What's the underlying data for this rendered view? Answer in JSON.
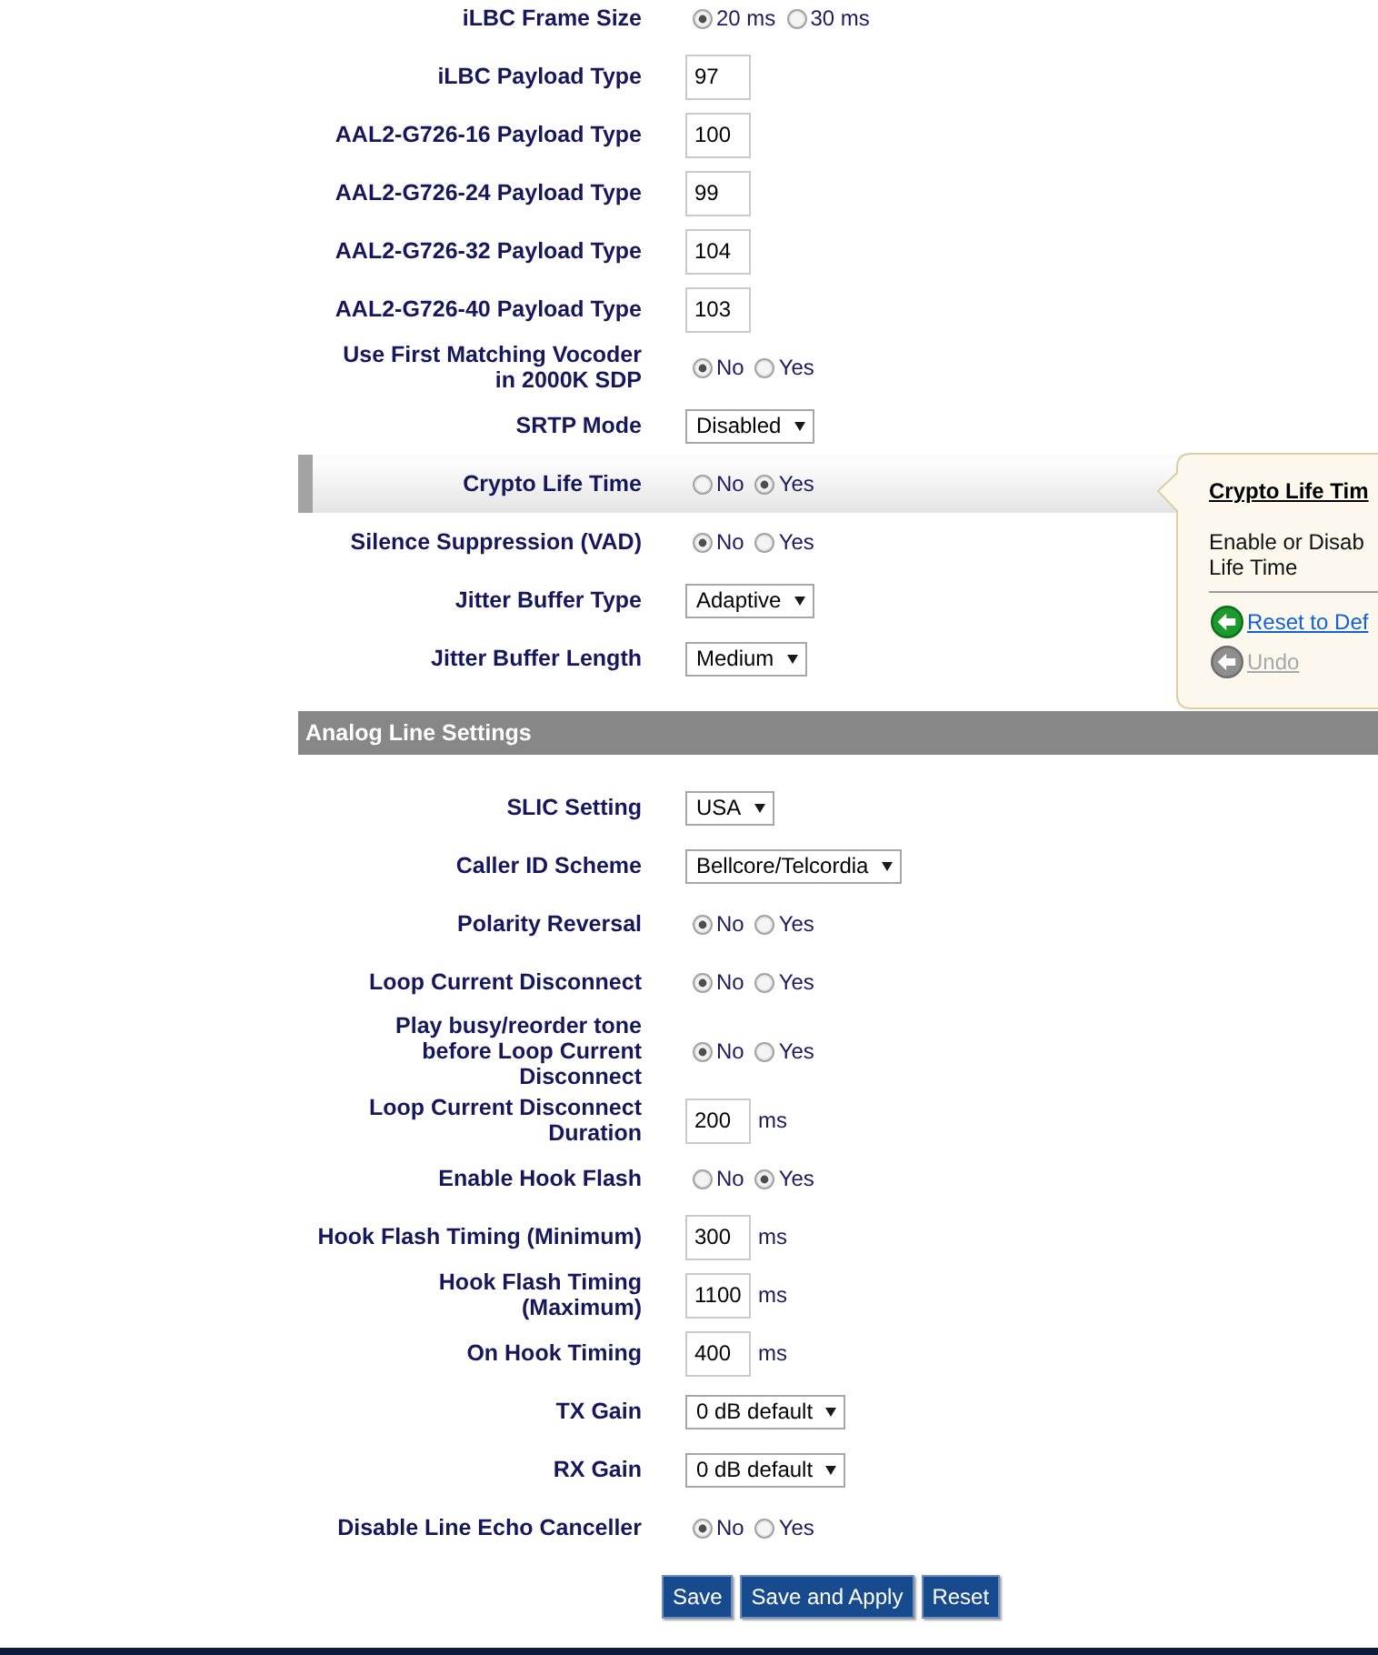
{
  "sections": [
    {
      "rows": [
        {
          "label": "iLBC Frame Size",
          "kind": "radio",
          "highlighted": false,
          "options": [
            {
              "label": "20 ms",
              "selected": true
            },
            {
              "label": "30 ms",
              "selected": false
            }
          ]
        },
        {
          "label": "iLBC Payload Type",
          "kind": "text",
          "highlighted": false,
          "value": "97"
        },
        {
          "label": "AAL2-G726-16 Payload Type",
          "kind": "text",
          "highlighted": false,
          "value": "100"
        },
        {
          "label": "AAL2-G726-24 Payload Type",
          "kind": "text",
          "highlighted": false,
          "value": "99"
        },
        {
          "label": "AAL2-G726-32 Payload Type",
          "kind": "text",
          "highlighted": false,
          "value": "104"
        },
        {
          "label": "AAL2-G726-40 Payload Type",
          "kind": "text",
          "highlighted": false,
          "value": "103"
        },
        {
          "label": "Use First Matching Vocoder\nin 2000K SDP",
          "kind": "radio",
          "highlighted": false,
          "options": [
            {
              "label": "No",
              "selected": true
            },
            {
              "label": "Yes",
              "selected": false
            }
          ]
        },
        {
          "label": "SRTP Mode",
          "kind": "select",
          "highlighted": false,
          "value": "Disabled"
        },
        {
          "label": "Crypto Life Time",
          "kind": "radio",
          "highlighted": true,
          "options": [
            {
              "label": "No",
              "selected": false
            },
            {
              "label": "Yes",
              "selected": true
            }
          ]
        },
        {
          "label": "Silence Suppression (VAD)",
          "kind": "radio",
          "highlighted": false,
          "options": [
            {
              "label": "No",
              "selected": true
            },
            {
              "label": "Yes",
              "selected": false
            }
          ]
        },
        {
          "label": "Jitter Buffer Type",
          "kind": "select",
          "highlighted": false,
          "value": "Adaptive"
        },
        {
          "label": "Jitter Buffer Length",
          "kind": "select",
          "highlighted": false,
          "value": "Medium"
        }
      ]
    },
    {
      "title": "Analog Line Settings",
      "rows": [
        {
          "label": "SLIC Setting",
          "kind": "select",
          "highlighted": false,
          "value": "USA"
        },
        {
          "label": "Caller ID Scheme",
          "kind": "select",
          "highlighted": false,
          "value": "Bellcore/Telcordia"
        },
        {
          "label": "Polarity Reversal",
          "kind": "radio",
          "highlighted": false,
          "options": [
            {
              "label": "No",
              "selected": true
            },
            {
              "label": "Yes",
              "selected": false
            }
          ]
        },
        {
          "label": "Loop Current Disconnect",
          "kind": "radio",
          "highlighted": false,
          "options": [
            {
              "label": "No",
              "selected": true
            },
            {
              "label": "Yes",
              "selected": false
            }
          ]
        },
        {
          "label": "Play busy/reorder tone\nbefore Loop Current\nDisconnect",
          "kind": "radio",
          "highlighted": false,
          "options": [
            {
              "label": "No",
              "selected": true
            },
            {
              "label": "Yes",
              "selected": false
            }
          ]
        },
        {
          "label": "Loop Current Disconnect\nDuration",
          "kind": "text",
          "highlighted": false,
          "value": "200",
          "unit": "ms"
        },
        {
          "label": "Enable Hook Flash",
          "kind": "radio",
          "highlighted": false,
          "options": [
            {
              "label": "No",
              "selected": false
            },
            {
              "label": "Yes",
              "selected": true
            }
          ]
        },
        {
          "label": "Hook Flash Timing (Minimum)",
          "kind": "text",
          "highlighted": false,
          "value": "300",
          "unit": "ms"
        },
        {
          "label": "Hook Flash Timing\n(Maximum)",
          "kind": "text",
          "highlighted": false,
          "value": "1100",
          "unit": "ms"
        },
        {
          "label": "On Hook Timing",
          "kind": "text",
          "highlighted": false,
          "value": "400",
          "unit": "ms"
        },
        {
          "label": "TX Gain",
          "kind": "select",
          "highlighted": false,
          "value": "0 dB default"
        },
        {
          "label": "RX Gain",
          "kind": "select",
          "highlighted": false,
          "value": "0 dB default"
        },
        {
          "label": "Disable Line Echo Canceller",
          "kind": "radio",
          "highlighted": false,
          "options": [
            {
              "label": "No",
              "selected": true
            },
            {
              "label": "Yes",
              "selected": false
            }
          ]
        }
      ]
    }
  ],
  "tooltip": {
    "title": "Crypto Life Tim",
    "text": "Enable or Disab\nLife Time",
    "links": [
      {
        "label": "Reset to Def",
        "disabled": false
      },
      {
        "label": "Undo",
        "disabled": true
      }
    ]
  },
  "buttons": [
    "Save",
    "Save and Apply",
    "Reset"
  ]
}
